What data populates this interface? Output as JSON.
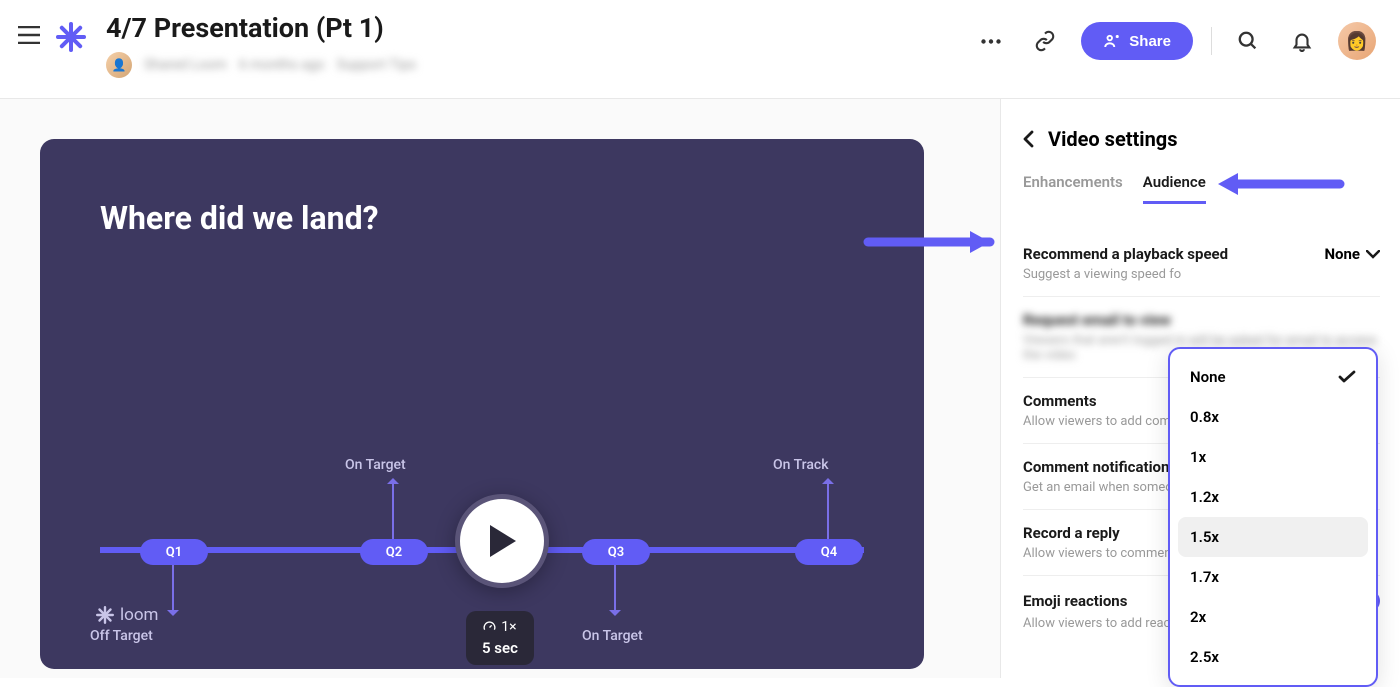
{
  "header": {
    "title": "4/7 Presentation (Pt 1)",
    "meta_name": "Shared Loom",
    "meta_time": "6 months ago",
    "meta_topic": "Support Tips",
    "share_label": "Share"
  },
  "video": {
    "slide_title": "Where did we land?",
    "quarters": {
      "q1": "Q1",
      "q2": "Q2",
      "q3": "Q3",
      "q4": "Q4"
    },
    "labels": {
      "q1_bottom": "Off Target",
      "q2_top": "On Target",
      "q3_bottom": "On Target",
      "q4_top": "On Track"
    },
    "speed_badge": "1×",
    "duration": "5 sec",
    "brand": "loom"
  },
  "settings": {
    "title": "Video settings",
    "tabs": {
      "enhancements": "Enhancements",
      "audience": "Audience"
    },
    "playback": {
      "label": "Recommend a playback speed",
      "desc": "Suggest a viewing speed fo",
      "value": "None"
    },
    "request_email": {
      "label": "Request email to view",
      "desc": "Viewers that aren't logged in will be asked for email to access the video"
    },
    "comments": {
      "label": "Comments",
      "desc": "Allow viewers to add comm"
    },
    "comment_notif": {
      "label": "Comment notification",
      "desc": "Get an email when someon"
    },
    "record_reply": {
      "label": "Record a reply",
      "desc": "Allow viewers to comment"
    },
    "emoji": {
      "label": "Emoji reactions",
      "desc": "Allow viewers to add reactions"
    }
  },
  "dropdown": {
    "options": [
      "None",
      "0.8x",
      "1x",
      "1.2x",
      "1.5x",
      "1.7x",
      "2x",
      "2.5x"
    ],
    "selected": "None",
    "hovered": "1.5x"
  }
}
